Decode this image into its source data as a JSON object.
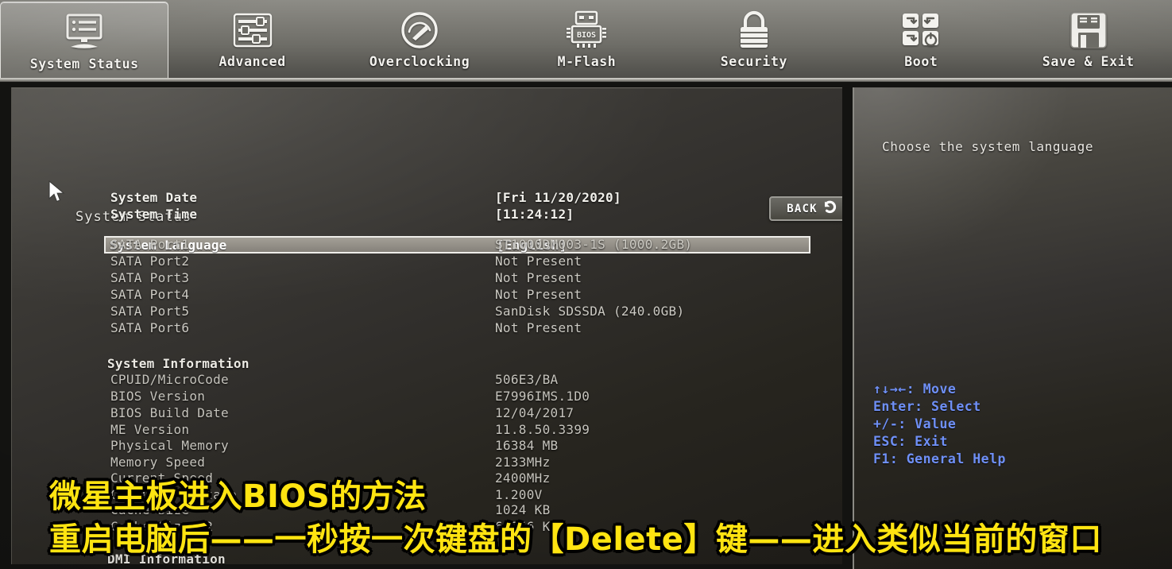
{
  "nav": {
    "tabs": [
      {
        "label": "System Status",
        "icon": "monitor-list-icon",
        "active": true
      },
      {
        "label": "Advanced",
        "icon": "sliders-icon",
        "active": false
      },
      {
        "label": "Overclocking",
        "icon": "gauge-icon",
        "active": false
      },
      {
        "label": "M-Flash",
        "icon": "bios-chip-icon",
        "active": false
      },
      {
        "label": "Security",
        "icon": "padlock-icon",
        "active": false
      },
      {
        "label": "Boot",
        "icon": "boot-grid-icon",
        "active": false
      },
      {
        "label": "Save & Exit",
        "icon": "floppy-disk-icon",
        "active": false
      }
    ]
  },
  "main": {
    "page_title": "System Status",
    "back_button": "BACK",
    "selected_row": {
      "key": "System Language",
      "value": "[English]"
    },
    "rows": [
      {
        "key": "System Date",
        "value": "[Fri 11/20/2020]",
        "style": "bright"
      },
      {
        "key": "System Time",
        "value": "[11:24:12]",
        "style": "bright"
      },
      {
        "key": "SATA Port1",
        "value": "ST1000DM003-1S  (1000.2GB)",
        "style": "dim"
      },
      {
        "key": "SATA Port2",
        "value": "Not Present",
        "style": "dim"
      },
      {
        "key": "SATA Port3",
        "value": "Not Present",
        "style": "dim"
      },
      {
        "key": "SATA Port4",
        "value": "Not Present",
        "style": "dim"
      },
      {
        "key": "SATA Port5",
        "value": "SanDisk SDSSDA  (240.0GB)",
        "style": "dim"
      },
      {
        "key": "SATA Port6",
        "value": "Not Present",
        "style": "dim"
      },
      {
        "key": "System Information",
        "value": "",
        "style": "sect"
      },
      {
        "key": "CPUID/MicroCode",
        "value": "506E3/BA",
        "style": "dim2"
      },
      {
        "key": "BIOS Version",
        "value": "E7996IMS.1D0",
        "style": "dim2"
      },
      {
        "key": "BIOS Build Date",
        "value": "12/04/2017",
        "style": "dim2"
      },
      {
        "key": "ME Version",
        "value": "11.8.50.3399",
        "style": "dim2"
      },
      {
        "key": "Physical Memory",
        "value": "16384 MB",
        "style": "dim2"
      },
      {
        "key": "Memory Speed",
        "value": "2133MHz",
        "style": "dim2"
      },
      {
        "key": "Current Speed",
        "value": "2400MHz",
        "style": "dim2"
      },
      {
        "key": "CPU Core Voltage",
        "value": "1.200V",
        "style": "dim2"
      },
      {
        "key": "Cache Size",
        "value": "1024 KB",
        "style": "dim2"
      },
      {
        "key": "Cache Size L2",
        "value": "6x256 KB",
        "style": "dim2"
      },
      {
        "key": "DMI Information",
        "value": "",
        "style": "sect"
      }
    ]
  },
  "help": {
    "description": "Choose the system language",
    "keys": [
      "↑↓→←: Move",
      "Enter: Select",
      "+/-: Value",
      "ESC: Exit",
      "F1: General Help"
    ]
  },
  "overlay": {
    "line1": "微星主板进入BIOS的方法",
    "line2": "重启电脑后——一秒按一次键盘的【Delete】键——进入类似当前的窗口"
  },
  "colors": {
    "accent_yellow": "#ffe411",
    "help_blue": "#6f90f7",
    "panel_dark": "#27251f",
    "nav_gray": "#83827c"
  }
}
